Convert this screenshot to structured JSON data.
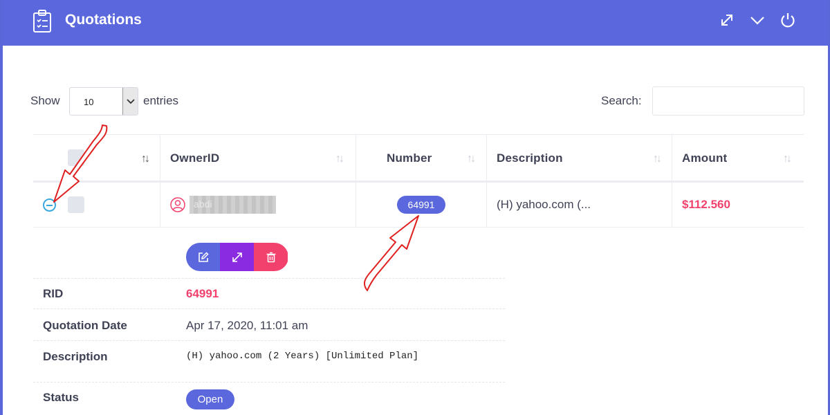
{
  "header": {
    "title": "Quotations",
    "icons": [
      "clipboard-icon",
      "expand-icon",
      "chevron-down-icon",
      "power-icon"
    ],
    "color": "#5b67dc"
  },
  "controls": {
    "show_label": "Show",
    "entries_value": "10",
    "entries_label": "entries",
    "search_label": "Search:",
    "search_value": ""
  },
  "table": {
    "columns": [
      "",
      "OwnerID",
      "Number",
      "Description",
      "Amount"
    ],
    "rows": [
      {
        "owner": "abdi",
        "number": "64991",
        "description": "(H) yahoo.com (...",
        "amount": "$112.560"
      }
    ]
  },
  "details": {
    "actions": [
      "edit-icon",
      "expand-icon",
      "trash-icon"
    ],
    "fields": [
      {
        "label": "RID",
        "value": "64991"
      },
      {
        "label": "Quotation Date",
        "value": "Apr 17, 2020, 11:01 am"
      },
      {
        "label": "Description",
        "value": "(H) yahoo.com (2 Years) [Unlimited Plan]"
      },
      {
        "label": "Status",
        "value": "Open"
      }
    ]
  },
  "colors": {
    "accent": "#5b67dc",
    "danger": "#f1416c",
    "purple": "#8a2be2",
    "annotation": "#e02020"
  }
}
